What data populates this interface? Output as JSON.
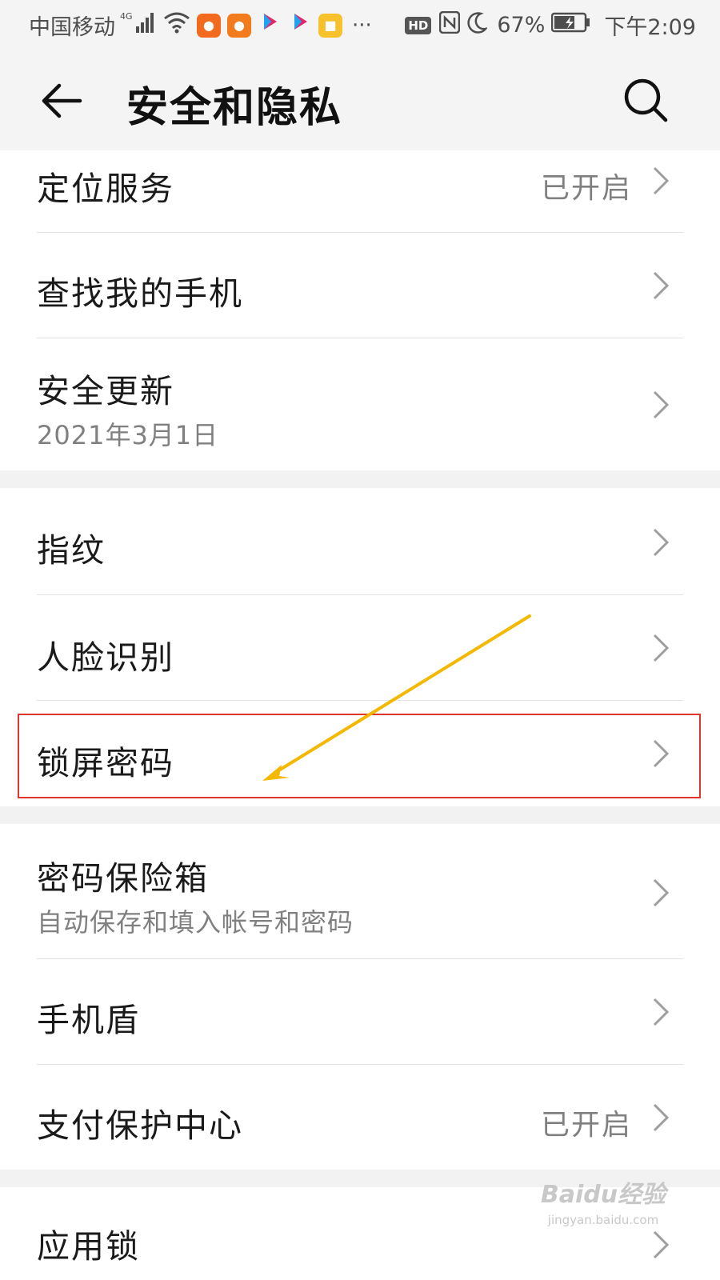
{
  "status_bar": {
    "carrier": "中国移动",
    "network": "4G",
    "battery": "67%",
    "time": "下午2:09",
    "hd": "HD"
  },
  "app_bar": {
    "title": "安全和隐私"
  },
  "items": [
    {
      "title": "定位服务",
      "value": "已开启"
    },
    {
      "title": "查找我的手机"
    },
    {
      "title": "安全更新",
      "subtitle": "2021年3月1日"
    },
    {
      "title": "指纹"
    },
    {
      "title": "人脸识别"
    },
    {
      "title": "锁屏密码"
    },
    {
      "title": "密码保险箱",
      "subtitle": "自动保存和填入帐号和密码"
    },
    {
      "title": "手机盾"
    },
    {
      "title": "支付保护中心",
      "value": "已开启"
    },
    {
      "title": "应用锁"
    }
  ],
  "annotation": {
    "box_color": "#e0352b",
    "arrow_color": "#f5b800"
  },
  "watermark": {
    "logo": "Baidu经验",
    "url": "jingyan.baidu.com"
  }
}
